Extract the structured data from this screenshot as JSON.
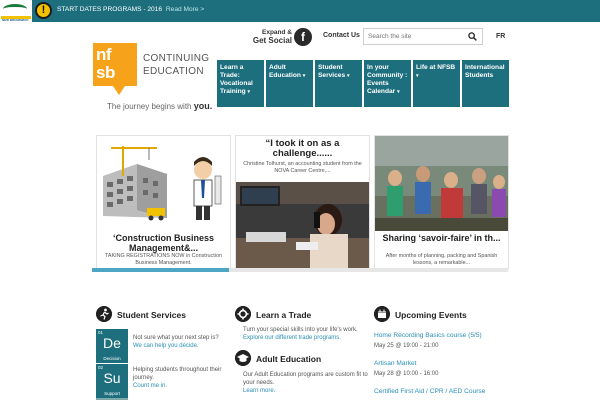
{
  "alert": {
    "text": "START DATES PROGRAMS - 2016",
    "link": "Read More >",
    "icon": "exclamation-icon",
    "symbol": "!"
  },
  "brand": {
    "logo_letters": [
      "nf",
      "sb"
    ],
    "title_lines": [
      "CONTINUING",
      "EDUCATION"
    ],
    "tagline": "The journey begins with",
    "tagline_em": "you.",
    "partner_tag": "NEW BRUNSWICK"
  },
  "header": {
    "expand_line1": "Expand &",
    "expand_line2": "Get Social",
    "facebook_glyph": "f",
    "contact": "Contact Us",
    "search_placeholder": "Search the site",
    "lang": "FR"
  },
  "nav": [
    {
      "label": "Learn a Trade: Vocational Training",
      "caret": "▾"
    },
    {
      "label": "Adult Education",
      "caret": "▾"
    },
    {
      "label": "Student Services",
      "caret": "▾"
    },
    {
      "label": "In your Community : Events Calendar",
      "caret": "▾"
    },
    {
      "label": "Life at NFSB",
      "caret": "▾"
    },
    {
      "label": "International Students",
      "caret": ""
    }
  ],
  "carousel": {
    "progress": 0.33,
    "cards": [
      {
        "title": "‘Construction Business Management&...",
        "desc": "TAKING REGISTRATIONS  NOW in Construction Business Management."
      },
      {
        "title": "“I took it on as a challenge......",
        "desc": "Christine Tolhurst, an accounting student from the NOVA Career Centre,..."
      },
      {
        "title": "Sharing ‘savoir-faire’ in th...",
        "desc": "After months of planning, packing and Spanish lessons, a remarkable..."
      }
    ]
  },
  "student_services": {
    "title": "Student Services",
    "icon": "running-person-icon",
    "tiles": [
      {
        "num": "01",
        "sym": "De",
        "name": "Decision",
        "text": "Not sure what your next step is?",
        "link": "We can help you decide."
      },
      {
        "num": "02",
        "sym": "Su",
        "name": "Support",
        "text": "Helping students throughout their journey.",
        "link": "Count me in."
      }
    ]
  },
  "trade": {
    "title": "Learn a Trade",
    "icon": "gear-icon",
    "text": "Turn your special skills into your life's work.",
    "link": "Explore our different trade programs."
  },
  "adult": {
    "title": "Adult Education",
    "icon": "graduation-cap-icon",
    "text": "Our Adult Education programs are custom fit to your needs.",
    "link": "Learn more."
  },
  "events": {
    "title": "Upcoming Events",
    "icon": "calendar-icon",
    "items": [
      {
        "title": "Home Recording Basics course (5/5)",
        "date": "May 25 @ 19:00 - 21:00"
      },
      {
        "title": "Artisan Market",
        "date": "May 28 @ 10:00 - 16:00"
      },
      {
        "title": "Certified First Aid / CPR / AED Course",
        "date": ""
      }
    ]
  },
  "colors": {
    "brand_teal": "#1e6f7e",
    "logo_orange": "#f6a21a",
    "alert_yellow": "#f2c200",
    "link_blue": "#2a8fb5"
  }
}
